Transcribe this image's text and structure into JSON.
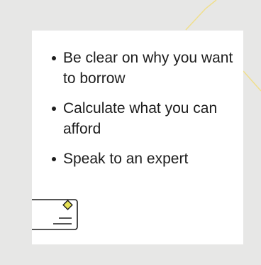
{
  "bullets": [
    {
      "text": "Be clear on why you want to borrow"
    },
    {
      "text": "Calculate what you can afford"
    },
    {
      "text": "Speak to an expert"
    }
  ],
  "icons": {
    "card": "credit-card-icon",
    "chip": "diamond-icon"
  },
  "colors": {
    "background": "#e7e7e6",
    "card": "#ffffff",
    "text": "#1d1d1d",
    "accent": "#e6e155",
    "decorative_line": "#f0df8c"
  }
}
